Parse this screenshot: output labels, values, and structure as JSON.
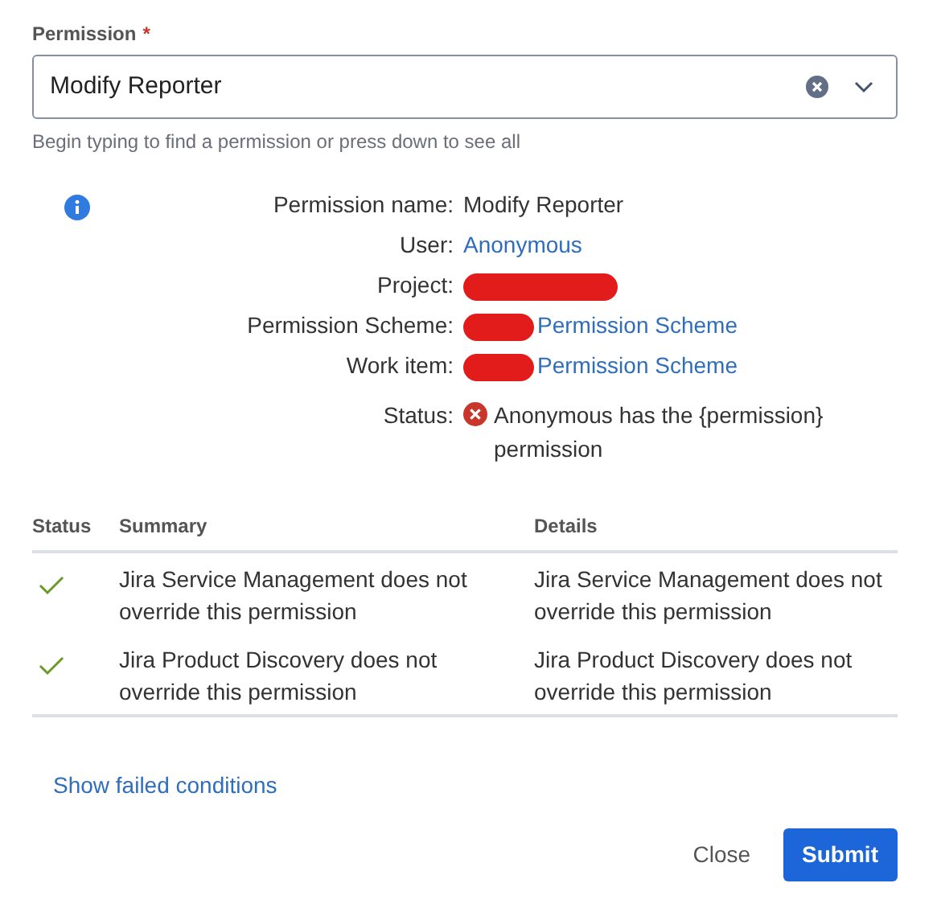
{
  "field": {
    "label": "Permission",
    "required_mark": "*",
    "value": "Modify Reporter",
    "help": "Begin typing to find a permission or press down to see all"
  },
  "details": [
    {
      "label": "Permission name:",
      "kind": "text",
      "value": "Modify Reporter",
      "redacted": false
    },
    {
      "label": "User:",
      "kind": "link",
      "value": "Anonymous",
      "redacted": false
    },
    {
      "label": "Project:",
      "kind": "text",
      "redacted": true
    },
    {
      "label": "Permission Scheme:",
      "kind": "link",
      "value": "Permission Scheme",
      "redacted": true
    },
    {
      "label": "Work item:",
      "kind": "link",
      "value": "Permission Scheme",
      "redacted": true
    },
    {
      "label": "Status:",
      "kind": "error",
      "value": "Anonymous has the {permission} permission",
      "redacted": false
    }
  ],
  "table": {
    "columns": [
      "Status",
      "Summary",
      "Details"
    ],
    "rows": [
      {
        "passed": true,
        "summary": "Jira Service Management does not override this permission",
        "details": "Jira Service Management does not override this permission"
      },
      {
        "passed": true,
        "summary": "Jira Product Discovery does not override this permission",
        "details": "Jira Product Discovery does not override this permission"
      }
    ]
  },
  "link": "Show failed conditions",
  "buttons": [
    {
      "label": "Close",
      "kind": "subtle"
    },
    {
      "label": "Submit",
      "kind": "primary"
    }
  ]
}
